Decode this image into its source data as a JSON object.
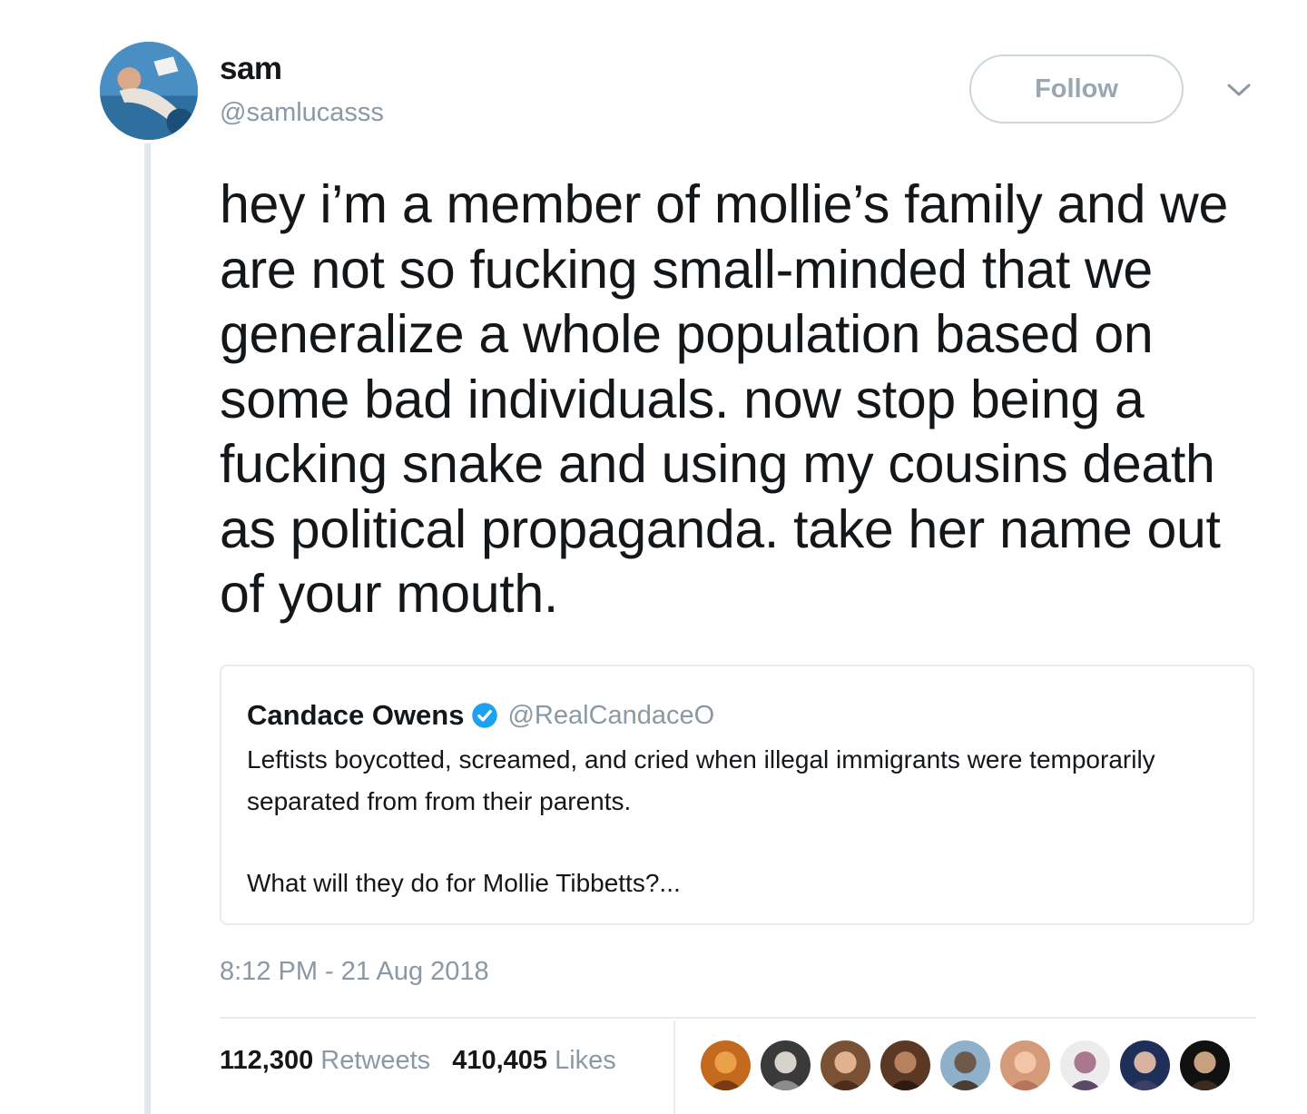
{
  "tweet": {
    "display_name": "sam",
    "handle": "@samlucasss",
    "follow_label": "Follow",
    "text": "hey i’m a member of mollie’s family and we are not so fucking small-minded that we generalize a whole population based on some bad individuals. now stop being a fucking snake and using my cousins death as political propaganda. take her name out of your mouth.",
    "timestamp": "8:12 PM - 21 Aug 2018",
    "retweets_count": "112,300",
    "retweets_label": "Retweets",
    "likes_count": "410,405",
    "likes_label": "Likes"
  },
  "quoted_tweet": {
    "name": "Candace Owens",
    "handle": "@RealCandaceO",
    "text_1": "Leftists boycotted, screamed, and cried when illegal immigrants were temporarily separated from from their parents.",
    "text_2": "What will they do for Mollie Tibbetts?..."
  },
  "colors": {
    "accent": "#1da1f2",
    "muted": "#8b98a5",
    "border": "#e6ecf0"
  },
  "likers_count_shown": 9
}
